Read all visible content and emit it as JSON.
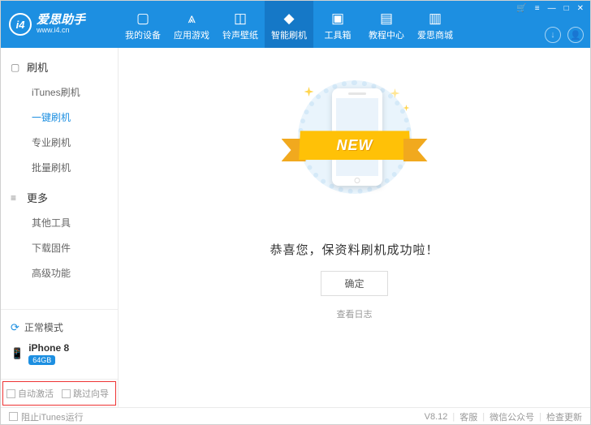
{
  "logo": {
    "glyph": "i4",
    "brand": "爱思助手",
    "url": "www.i4.cn"
  },
  "nav": {
    "items": [
      {
        "label": "我的设备",
        "icon": "▢"
      },
      {
        "label": "应用游戏",
        "icon": "⩓"
      },
      {
        "label": "铃声壁纸",
        "icon": "◫"
      },
      {
        "label": "智能刷机",
        "icon": "◆",
        "active": true
      },
      {
        "label": "工具箱",
        "icon": "▣"
      },
      {
        "label": "教程中心",
        "icon": "▤"
      },
      {
        "label": "爱思商城",
        "icon": "▥"
      }
    ]
  },
  "titlebar": {
    "cart": "🛒",
    "menu": "≡",
    "min": "—",
    "max": "□",
    "close": "✕"
  },
  "headerRight": {
    "download": "↓",
    "user": "👤"
  },
  "sidebar": {
    "cat1": {
      "icon": "▢",
      "label": "刷机"
    },
    "items1": [
      {
        "label": "iTunes刷机"
      },
      {
        "label": "一键刷机",
        "active": true
      },
      {
        "label": "专业刷机"
      },
      {
        "label": "批量刷机"
      }
    ],
    "cat2": {
      "icon": "≡",
      "label": "更多"
    },
    "items2": [
      {
        "label": "其他工具"
      },
      {
        "label": "下载固件"
      },
      {
        "label": "高级功能"
      }
    ],
    "mode": {
      "icon": "⟳",
      "label": "正常模式"
    },
    "device": {
      "icon": "📱",
      "name": "iPhone 8",
      "badge": "64GB"
    },
    "opts": {
      "auto": "自动激活",
      "skip": "跳过向导"
    }
  },
  "main": {
    "ribbon": "NEW",
    "msg": "恭喜您，保资料刷机成功啦！",
    "btn": "确定",
    "log": "查看日志"
  },
  "footer": {
    "block": "阻止iTunes运行",
    "version": "V8.12",
    "support": "客服",
    "wechat": "微信公众号",
    "update": "检查更新"
  }
}
